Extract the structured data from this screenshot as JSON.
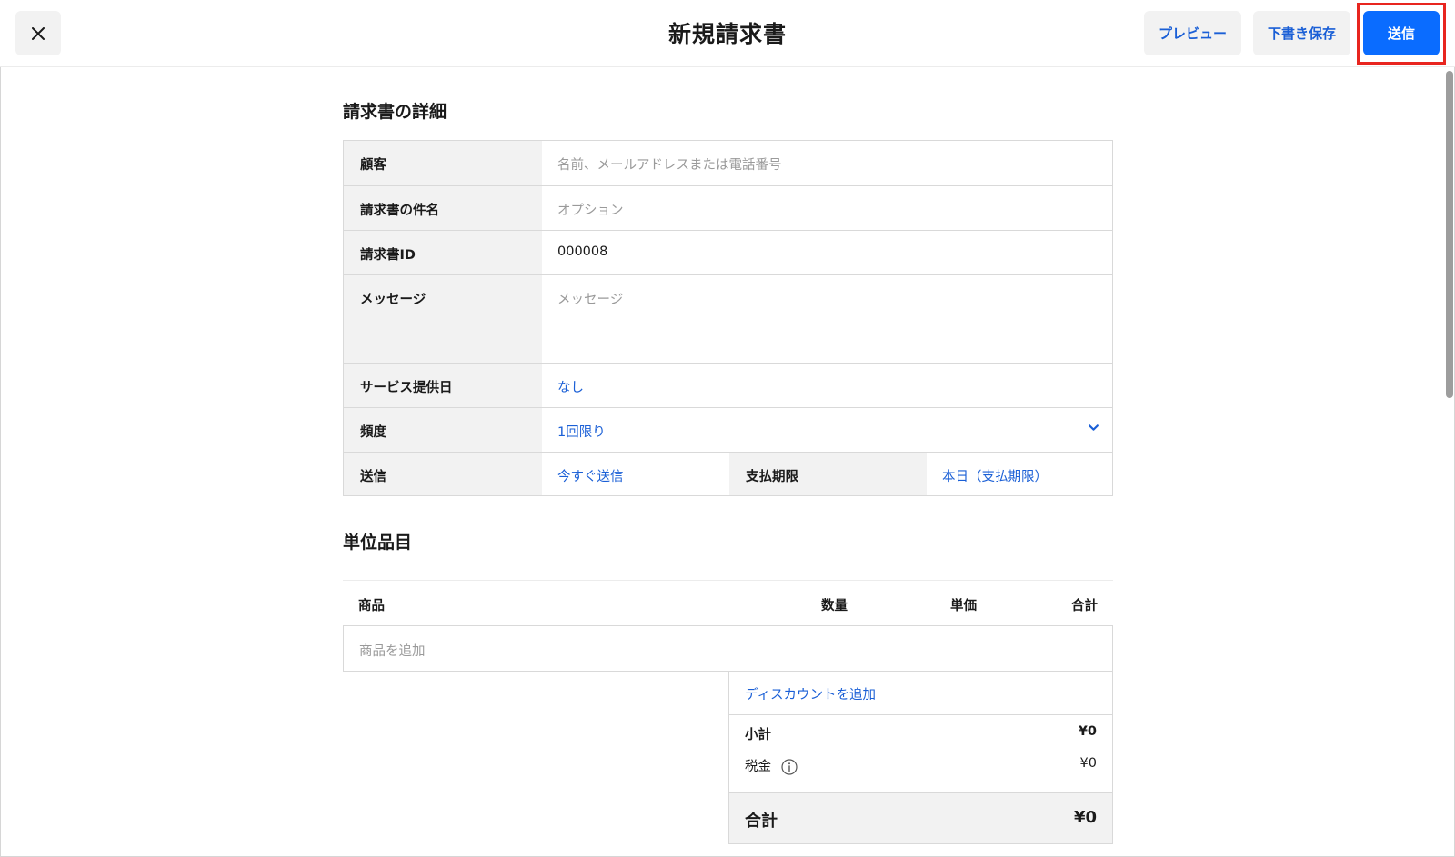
{
  "header": {
    "title": "新規請求書",
    "preview_label": "プレビュー",
    "draft_label": "下書き保存",
    "send_label": "送信"
  },
  "details": {
    "section_title": "請求書の詳細",
    "customer_label": "顧客",
    "customer_placeholder": "名前、メールアドレスまたは電話番号",
    "subject_label": "請求書の件名",
    "subject_placeholder": "オプション",
    "invoice_id_label": "請求書ID",
    "invoice_id_value": "000008",
    "message_label": "メッセージ",
    "message_placeholder": "メッセージ",
    "service_date_label": "サービス提供日",
    "service_date_value": "なし",
    "frequency_label": "頻度",
    "frequency_value": "1回限り",
    "send_label": "送信",
    "send_value": "今すぐ送信",
    "due_label": "支払期限",
    "due_value": "本日（支払期限）"
  },
  "items": {
    "section_title": "単位品目",
    "columns": [
      "商品",
      "数量",
      "単価",
      "合計"
    ],
    "add_product_placeholder": "商品を追加"
  },
  "summary": {
    "discount_label": "ディスカウントを追加",
    "subtotal_label": "小計",
    "subtotal_value": "¥0",
    "tax_label": "税金",
    "tax_value": "¥0",
    "total_label": "合計",
    "total_value": "¥0"
  }
}
